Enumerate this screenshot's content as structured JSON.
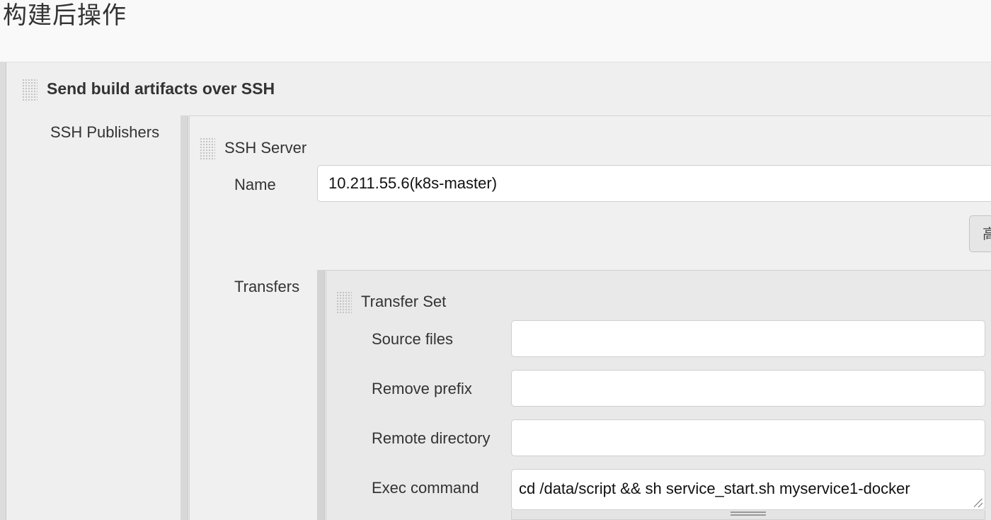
{
  "section": {
    "title": "构建后操作"
  },
  "plugin": {
    "title": "Send build artifacts over SSH",
    "publishers_label": "SSH Publishers"
  },
  "ssh_server": {
    "title": "SSH Server",
    "name_label": "Name",
    "name_value": "10.211.55.6(k8s-master)",
    "advanced_button_label": "高",
    "transfers_label": "Transfers"
  },
  "transfer_set": {
    "title": "Transfer Set",
    "source_files_label": "Source files",
    "source_files_value": "",
    "remove_prefix_label": "Remove prefix",
    "remove_prefix_value": "",
    "remote_directory_label": "Remote directory",
    "remote_directory_value": "",
    "exec_command_label": "Exec command",
    "exec_command_value": "cd /data/script && sh service_start.sh myservice1-docker"
  },
  "icons": {
    "drag_handle": "drag-handle-icon",
    "resize": "resize-grip-icon"
  },
  "colors": {
    "panel_bg": "#efefef",
    "header_bg": "#f9f9f9",
    "input_bg": "#ffffff",
    "border": "#cfcfcf"
  }
}
